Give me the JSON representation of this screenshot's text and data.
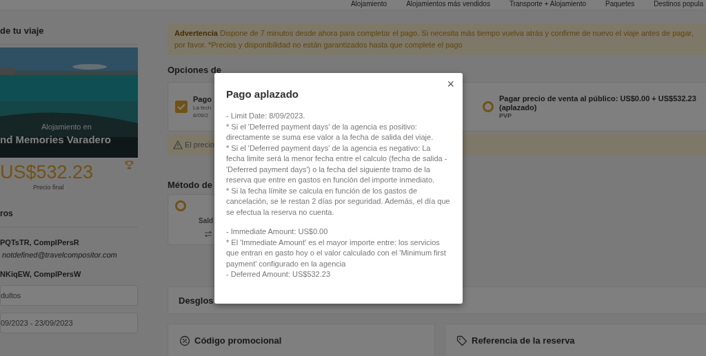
{
  "nav": [
    {
      "label": "Alojamiento"
    },
    {
      "label": "Alojamientos más vendidos"
    },
    {
      "label": "Transporte + Alojamiento"
    },
    {
      "label": "Paquetes"
    },
    {
      "label": "Destinos popula"
    }
  ],
  "summary": {
    "title": "de tu viaje",
    "image_caption": "Alojamiento en",
    "hotel": "nd Memories Varadero",
    "price": "US$532.23",
    "price_label": "Precio final",
    "travellers_title": "ros",
    "travellers": [
      {
        "name": "PQTsTR, ComplPersR",
        "email": "notdefined@travelcompositor.com"
      },
      {
        "name": "NKiqEW, ComplPersW"
      }
    ],
    "fields": [
      "dultos",
      "09/2023 - 23/09/2023"
    ]
  },
  "warning": "**Advertencia** Dispone de 7 minutos desde ahora para completar el pago. Si necesita más tiempo vuelva atrás y confirme de nuevo el viaje antes de pagar, por favor. *Precios y disponibilidad no están garantizados hasta que complete el pago",
  "payment_options": {
    "title": "Opciones de",
    "options": [
      {
        "kind": "checkbox",
        "selected": true,
        "title": "Pago",
        "lines": [
          "La fech",
          "8/09/2"
        ]
      },
      {
        "kind": "radio",
        "selected": false,
        "title": "Pagar precio de venta al público: US$0.00 + US$532.23 (aplazado)",
        "lines": [
          "PVP"
        ]
      }
    ],
    "notice": "El precio"
  },
  "payment_method": {
    "title": "Método de",
    "options": [
      {
        "selected": false,
        "label": "Sald"
      }
    ]
  },
  "breakdown": {
    "title": "Desglos"
  },
  "promo": {
    "title": "Código promocional"
  },
  "reference": {
    "title": "Referencia de la reserva"
  },
  "modal": {
    "title": "Pago aplazado",
    "close": "×",
    "blocks": [
      [
        "- Limit Date: 8/09/2023.",
        "* Si el 'Deferred payment days' de la agencia es positivo: directamente se suma ese valor a la fecha de salida del viaje.",
        "* Si el 'Deferred payment days' de la agencia es negativo: La fecha limite será la menor fecha entre el calculo (fecha de salida - 'Deferred payment days') o la fecha del siguiente tramo de la reserva que entre en gastos en función del importe inmediato.",
        "* Si la fecha límite se calcula en función de los gastos de cancelación, se le restan 2 días por seguridad. Además, el día que se efectua la reserva no cuenta."
      ],
      [
        "- Immediate Amount: US$0.00",
        "* El 'Immediate Amount' es el mayor importe entre: los servicios que entran en gasto hoy o el valor calculado con el 'Minimum first payment' configurado en la agencia",
        "- Deferred Amount: US$532.23"
      ]
    ]
  }
}
